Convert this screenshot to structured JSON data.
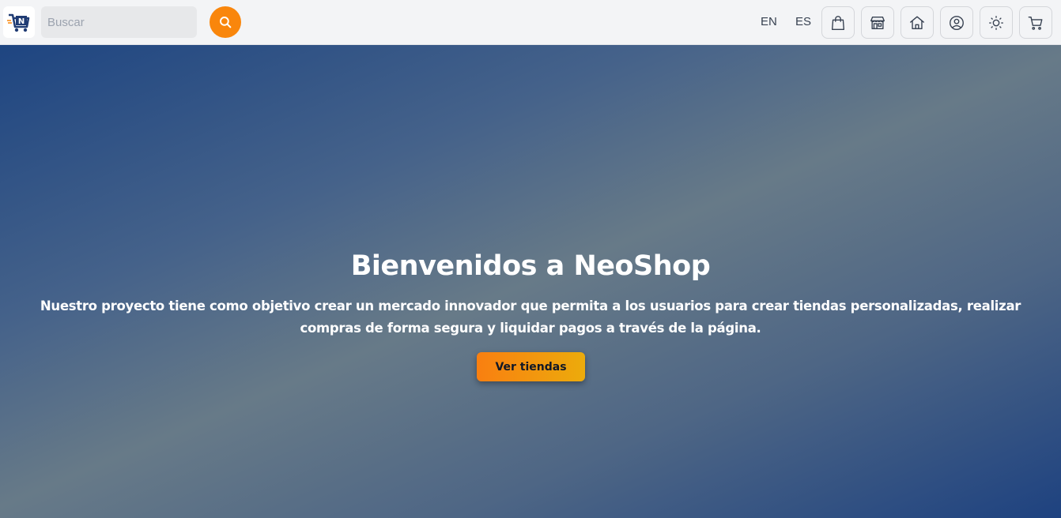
{
  "navbar": {
    "logo_icon": "neoshop-cart-logo-icon",
    "search": {
      "placeholder": "Buscar",
      "value": "",
      "button_icon": "search-icon"
    },
    "languages": [
      "EN",
      "ES"
    ],
    "icons": [
      "shopping-bag-icon",
      "store-icon",
      "home-icon",
      "user-circle-icon",
      "sun-icon",
      "cart-icon"
    ]
  },
  "hero": {
    "title": "Bienvenidos a NeoShop",
    "description": "Nuestro proyecto tiene como objetivo crear un mercado innovador que permita a los usuarios para crear tiendas personalizadas, realizar compras de forma segura y liquidar pagos a través de la página.",
    "cta_label": "Ver tiendas"
  },
  "colors": {
    "accent": "#f9860c",
    "cta_gradient_start": "#f97f10",
    "cta_gradient_end": "#ecab0c",
    "hero_dark": "#1e4581",
    "hero_light": "#677a88"
  }
}
